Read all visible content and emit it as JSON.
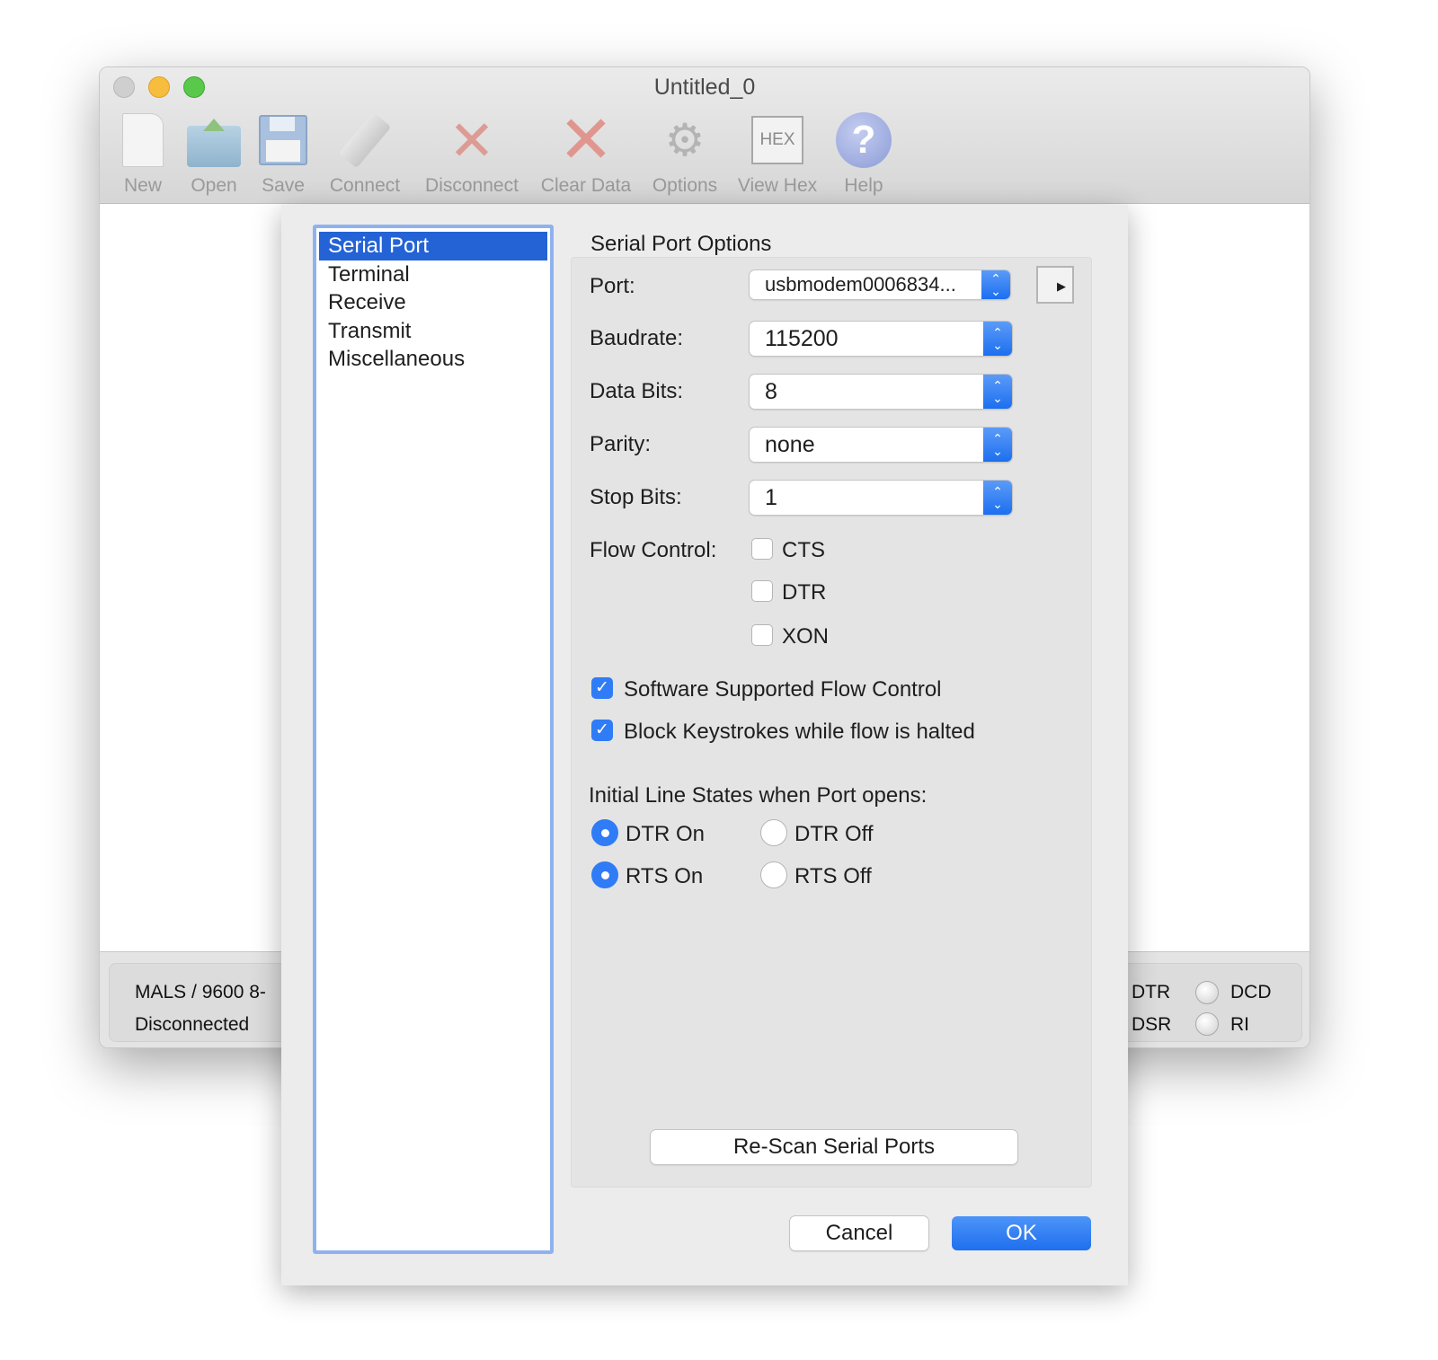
{
  "window": {
    "title": "Untitled_0"
  },
  "toolbar": [
    {
      "label": "New",
      "icon": "new-document-icon"
    },
    {
      "label": "Open",
      "icon": "open-folder-icon"
    },
    {
      "label": "Save",
      "icon": "floppy-disk-icon"
    },
    {
      "label": "Connect",
      "icon": "usb-plug-icon"
    },
    {
      "label": "Disconnect",
      "icon": "usb-disconnect-icon"
    },
    {
      "label": "Clear Data",
      "icon": "red-x-icon"
    },
    {
      "label": "Options",
      "icon": "gears-icon"
    },
    {
      "label": "View Hex",
      "icon": "hex-icon",
      "glyph": "HEX"
    },
    {
      "label": "Help",
      "icon": "help-icon",
      "glyph": "?"
    }
  ],
  "status": {
    "line1": "MALS / 9600 8-",
    "line2": "Disconnected",
    "leds": [
      "DTR",
      "DCD",
      "DSR",
      "RI"
    ]
  },
  "dialog": {
    "categories": [
      "Serial Port",
      "Terminal",
      "Receive",
      "Transmit",
      "Miscellaneous"
    ],
    "selected_category": "Serial Port",
    "section_title": "Serial Port Options",
    "port": {
      "label": "Port:",
      "value": "usbmodem0006834..."
    },
    "baudrate": {
      "label": "Baudrate:",
      "value": "115200"
    },
    "data_bits": {
      "label": "Data Bits:",
      "value": "8"
    },
    "parity": {
      "label": "Parity:",
      "value": "none"
    },
    "stop_bits": {
      "label": "Stop Bits:",
      "value": "1"
    },
    "flow_control": {
      "label": "Flow Control:",
      "options": [
        {
          "label": "CTS",
          "checked": false
        },
        {
          "label": "DTR",
          "checked": false
        },
        {
          "label": "XON",
          "checked": false
        }
      ]
    },
    "software_flow": {
      "label": "Software Supported Flow Control",
      "checked": true
    },
    "block_keys": {
      "label": "Block Keystrokes while flow is halted",
      "checked": true
    },
    "line_states": {
      "label": "Initial Line States when Port opens:",
      "dtr_on": "DTR On",
      "dtr_off": "DTR Off",
      "rts_on": "RTS On",
      "rts_off": "RTS Off",
      "dtr": "on",
      "rts": "on"
    },
    "rescan": "Re-Scan Serial Ports",
    "cancel": "Cancel",
    "ok": "OK",
    "checkmark": "✓",
    "up_arrow": "⌃",
    "down_arrow": "⌄",
    "more_arrow": "▶"
  },
  "colors": {
    "accent": "#2f7cf6",
    "selection": "#2463d6"
  }
}
